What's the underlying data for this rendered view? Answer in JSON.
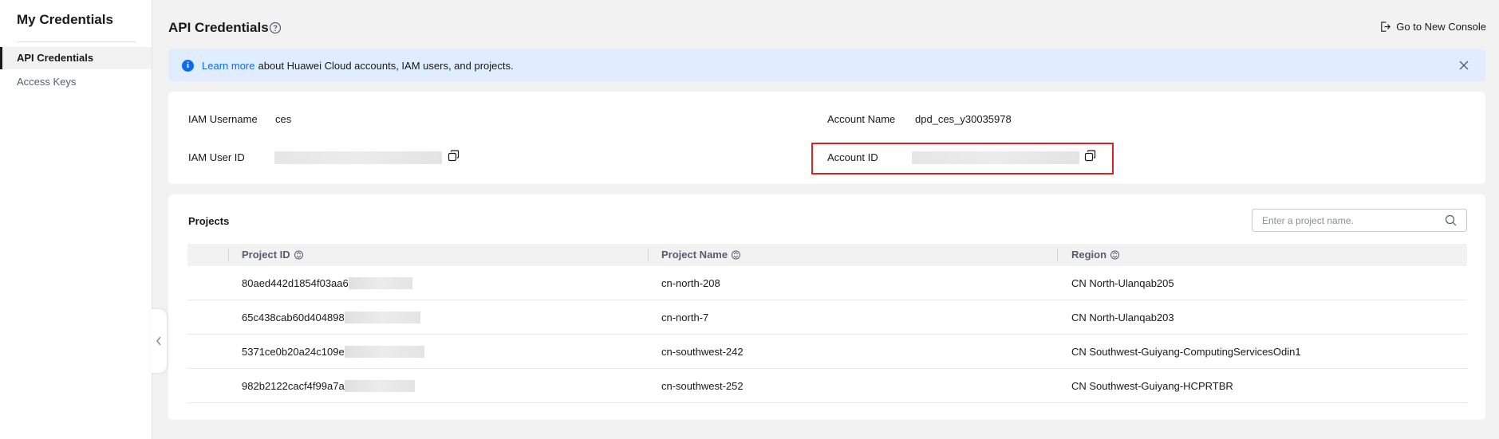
{
  "sidebar": {
    "title": "My Credentials",
    "items": [
      {
        "label": "API Credentials",
        "active": true
      },
      {
        "label": "Access Keys",
        "active": false
      }
    ]
  },
  "header": {
    "title": "API Credentials",
    "console_link": "Go to New Console"
  },
  "alert": {
    "link": "Learn more",
    "text": "about Huawei Cloud accounts, IAM users, and projects."
  },
  "info": {
    "iam_username_label": "IAM Username",
    "iam_username": "ces",
    "iam_user_id_label": "IAM User ID",
    "account_name_label": "Account Name",
    "account_name": "dpd_ces_y30035978",
    "account_id_label": "Account ID",
    "highlight_color": "#e02020"
  },
  "projects": {
    "title": "Projects",
    "search_placeholder": "Enter a project name.",
    "columns": [
      "Project ID",
      "Project Name",
      "Region"
    ],
    "rows": [
      {
        "id": "80aed442d1854f03aa6",
        "name": "cn-north-208",
        "region": "CN North-Ulanqab205"
      },
      {
        "id": "65c438cab60d404898",
        "name": "cn-north-7",
        "region": "CN North-Ulanqab203"
      },
      {
        "id": "5371ce0b20a24c109e",
        "name": "cn-southwest-242",
        "region": "CN Southwest-Guiyang-ComputingServicesOdin1"
      },
      {
        "id": "982b2122cacf4f99a7a",
        "name": "cn-southwest-252",
        "region": "CN Southwest-Guiyang-HCPRTBR"
      }
    ]
  },
  "colors": {
    "accent": "#0a6cf4",
    "alert_bg": "#dfedff",
    "page_bg": "#f2f2f2"
  }
}
